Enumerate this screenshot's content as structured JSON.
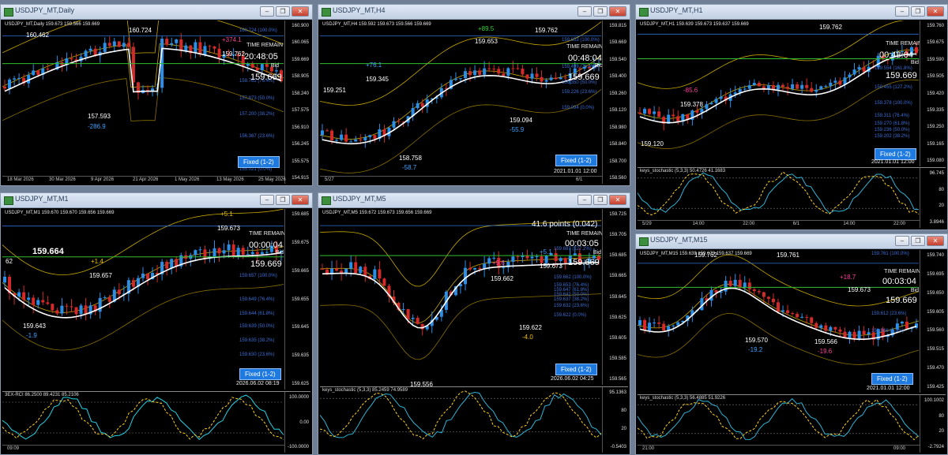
{
  "colors": {
    "bull": "#2b7fd6",
    "bear": "#c82020",
    "accent": "#1f7ae0",
    "bg": "#000000"
  },
  "windows": [
    {
      "key": "daily",
      "title": "USDJPY_MT,Daily",
      "header": "USDJPY_MT,Daily 159.673 159.566 159.669",
      "time_remain_label": "TIME REMAIN",
      "time_remain": "20:48:05",
      "bid_label": "Bid",
      "bid": "159.669",
      "fixed": "Fixed (1-2)",
      "prices": [
        "160.900",
        "160.065",
        "159.669",
        "158.905",
        "158.240",
        "157.575",
        "156.910",
        "156.245",
        "155.575",
        "154.915"
      ],
      "fib": [
        "160.724 (100.0%)",
        "159.762 (76.4%)",
        "159.132 (61.8%)",
        "157.873 (50.0%)",
        "157.200 (38.2%)",
        "156.367 (23.6%)",
        "155.021 (0.0%)"
      ],
      "labels": {
        "a": "160.462",
        "b": "160.724",
        "c": "159.762",
        "d": "157.593",
        "e": "-286.9",
        "f": "+374.1",
        "g": "159.763"
      },
      "dates": [
        "18 Mar 2026",
        "30 Mar 2026",
        "9 Apr 2026",
        "21 Apr 2026",
        "1 May 2026",
        "13 May 2026",
        "25 May 2026"
      ]
    },
    {
      "key": "h4",
      "title": "USDJPY_MT,H4",
      "header": "USDJPY_MT,H4 159.592 159.673 159.566 159.669",
      "time_remain_label": "TIME REMAIN",
      "time_remain": "00:48:04",
      "bid_label": "Bid",
      "bid": "159.669",
      "fixed": "Fixed (1-2)",
      "stamp": "2021.01.01 12:00",
      "prices": [
        "159.815",
        "159.669",
        "159.540",
        "159.400",
        "159.260",
        "159.120",
        "158.980",
        "158.840",
        "158.700",
        "158.560"
      ],
      "fib": [
        "159.653 (100.0%)",
        "159.499 (76.4%)",
        "159.409 (61.8%)",
        "159.350 (50.0%)",
        "159.226 (23.6%)",
        "159.094 (0.0%)"
      ],
      "labels": {
        "a": "159.762",
        "b": "159.653",
        "c": "159.345",
        "d": "159.251",
        "e": "158.758",
        "f": "-58.7",
        "g": "+76.1",
        "h": "159.094",
        "i": "-55.9",
        "j": "+89.5"
      },
      "dates": [
        "5/27",
        "6/1"
      ]
    },
    {
      "key": "h1",
      "title": "USDJPY_MT,H1",
      "header": "USDJPY_MT,H1 159.639 159.673 159.637 159.669",
      "time_remain_label": "TIME REMAIN",
      "time_remain": "00:48:04",
      "bid_label": "Bid",
      "bid": "159.669",
      "fixed": "Fixed (1-2)",
      "stamp": "2021.01.01 12:00",
      "prices": [
        "159.760",
        "159.675",
        "159.590",
        "159.505",
        "159.420",
        "159.335",
        "159.250",
        "159.165",
        "159.080"
      ],
      "fib": [
        "159.554 (161.8%)",
        "159.455 (127.2%)",
        "159.378 (100.0%)",
        "159.311 (76.4%)",
        "159.270 (61.8%)",
        "159.236 (50.0%)",
        "159.202 (38.2%)",
        "159.161 (23.6%)"
      ],
      "labels": {
        "a": "159.762",
        "b": "159.378",
        "c": "159.120",
        "d": "-85.6"
      },
      "sub_header": "keys_stochastic (5,3,3) 50.4726 41.1683",
      "sub_axis": [
        "96.745",
        "80",
        "20",
        "3.8946"
      ],
      "dates": [
        "5/29",
        "14:00",
        "22:00",
        "6/1",
        "14:00",
        "22:00"
      ]
    },
    {
      "key": "m1",
      "title": "USDJPY_MT,M1",
      "header": "USDJPY_MT,M1 159.670 159.670 159.656 159.669",
      "time_remain_label": "TIME REMAIN",
      "time_remain": "00:00:04",
      "bid_label": "Bid",
      "bid": "159.669",
      "fixed": "Fixed (1-2)",
      "stamp": "2026.06.02 08:19",
      "big_price": "159.664",
      "prices": [
        "159.685",
        "159.675",
        "159.665",
        "159.655",
        "159.645",
        "159.635",
        "159.625"
      ],
      "fib": [
        "159.679 (161.8%)",
        "159.671 (127.2%)",
        "159.657 (100.0%)",
        "159.649 (76.4%)",
        "159.644 (61.8%)",
        "159.639 (50.0%)",
        "159.635 (38.2%)",
        "159.630 (23.6%)"
      ],
      "labels": {
        "a": "159.673",
        "b": "159.657",
        "c": "159.643",
        "d": "-1.9",
        "e": "+1.4",
        "f": "+5.1",
        "g": "62"
      },
      "sub_header": "3EX-RCI 86.2500 89.4231 85.2106",
      "sub_axis": [
        "100.0000",
        "0.00",
        "-100.0000"
      ],
      "dates": [
        "09:09"
      ]
    },
    {
      "key": "m5",
      "title": "USDJPY_MT,M5",
      "header": "USDJPY_MT,M5 159.672 159.673 159.656 159.669",
      "points": "41.6 points (0.042)",
      "time_remain_label": "TIME REMAIN",
      "time_remain": "00:03:05",
      "bid_label": "Bid",
      "bid": "159.669",
      "fixed": "Fixed (1-2)",
      "stamp": "2026.06.02 04:25",
      "prices": [
        "159.725",
        "159.705",
        "159.685",
        "159.665",
        "159.645",
        "159.625",
        "159.605",
        "159.585",
        "159.565"
      ],
      "fib": [
        "159.687 (127.2%)",
        "159.662 (100.0%)",
        "159.653 (76.4%)",
        "159.647 (61.8%)",
        "159.642 (50.0%)",
        "159.637 (38.2%)",
        "159.632 (23.6%)",
        "159.622 (0.0%)"
      ],
      "labels": {
        "a": "159.673",
        "b": "159.662",
        "c": "159.622",
        "d": "-4.0",
        "e": "+9.6",
        "f": "+5.1",
        "g": "159.556"
      },
      "sub_header": "keys_stochastic (5,3,3) 85.2459 74.9589",
      "sub_axis": [
        "95.1363",
        "80",
        "20",
        "-0.5403"
      ],
      "dates": []
    },
    {
      "key": "m15",
      "title": "USDJPY_MT,M15",
      "header": "USDJPY_MT,M15 159.639 159.673 159.637 159.669",
      "time_remain_label": "TIME REMAIN",
      "time_remain": "00:03:04",
      "bid_label": "Bid",
      "bid": "159.669",
      "fixed": "Fixed (1-2)",
      "stamp": "2021.01.01 12:00",
      "prices": [
        "159.740",
        "159.695",
        "159.650",
        "159.605",
        "159.560",
        "159.515",
        "159.470",
        "159.425"
      ],
      "fib": [
        "159.761 (100.0%)",
        "159.612 (23.6%)",
        "159.566 (0.0%)"
      ],
      "labels": {
        "a": "159.761",
        "b": "159.673",
        "c": "159.570",
        "d": "159.566",
        "e": "-19.2",
        "f": "+18.7",
        "g": "-19.6",
        "h": "159.762"
      },
      "sub_header": "keys_stochastic (5,3,3) 56.4885 51.9226",
      "sub_axis": [
        "100.1002",
        "80",
        "20",
        "-2.7924"
      ],
      "dates": [
        "21:00",
        "09:00"
      ]
    }
  ]
}
